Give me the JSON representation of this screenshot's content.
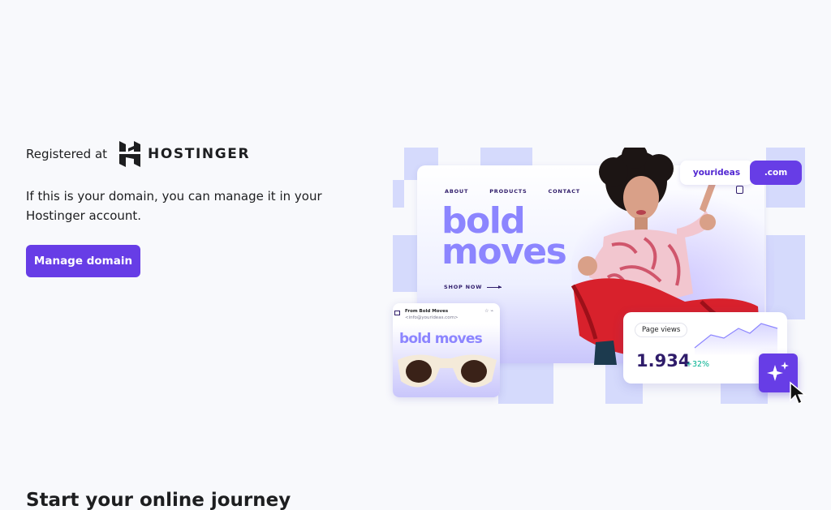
{
  "registration": {
    "prefix": "Registered at",
    "brand_name": "HOSTINGER"
  },
  "description": "If this is your domain, you can manage it in your Hostinger account.",
  "manage_button": "Manage domain",
  "section_heading": "Start your online journey",
  "illustration": {
    "nav": [
      "ABOUT",
      "PRODUCTS",
      "CONTACT"
    ],
    "headline_line1": "bold",
    "headline_line2": "moves",
    "cta": "SHOP NOW",
    "domain_name": "yourideas",
    "domain_tld": ".com",
    "email_from": "From Bold Moves",
    "email_address": "<info@yourideas.com>",
    "email_title": "bold moves",
    "stats_label": "Page views",
    "stats_value": "1.934",
    "stats_delta": "+32%"
  },
  "colors": {
    "brand": "#673de6",
    "accent_light": "#8c85ff",
    "checker": "#d5dafc",
    "positive": "#00b090"
  }
}
